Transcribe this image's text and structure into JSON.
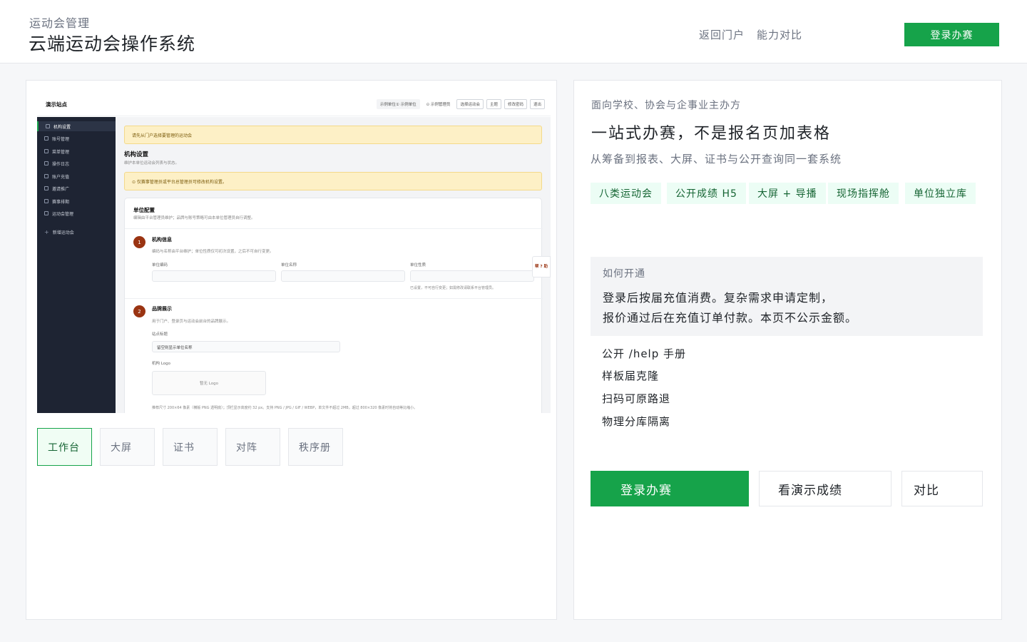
{
  "header": {
    "subtitle": "运动会管理",
    "title": "云端运动会操作系统",
    "nav_back": "返回门户",
    "nav_compare": "能力对比",
    "login_button": "登录办赛"
  },
  "preview": {
    "site_name": "演示站点",
    "top_chips": [
      "示例单位① 示例单位",
      "⊙ 示例管理员",
      "选择运动会",
      "主题",
      "修改密码",
      "退出"
    ],
    "sidebar": [
      "机构设置",
      "账号管理",
      "菜单管理",
      "操作日志",
      "账户充值",
      "邀请推广",
      "赛事排期",
      "运动会管理",
      "新增运动会"
    ],
    "alert_select": "请先从门户选择要管理的运动会",
    "page_title": "机构设置",
    "page_subtitle": "维护本单位运动会列表与状态。",
    "alert_permission": "⊙ 仅赛事管理员或平台总管理员可修改机构设置。",
    "panel_title": "单位配置",
    "panel_subtitle": "编辑由平台管理员维护；品牌与账号策略可由本单位管理员自行调整。",
    "step1": {
      "num": "1",
      "title": "机构信息",
      "desc": "编码与名称由平台维护；单位性质仅可初次设置，之后不可自行变更。",
      "label_code": "单位编码",
      "label_name": "单位名称",
      "label_type": "单位性质",
      "hint": "已设置，不可自行变更；如需修改请联系平台管理员。"
    },
    "step2": {
      "num": "2",
      "title": "品牌展示",
      "desc": "用于门户、登录页与运动会前台的品牌展示。",
      "label_site_title": "站点标题",
      "site_title_placeholder": "留空则显示单位名称",
      "label_logo": "机构 Logo",
      "logo_placeholder": "暂无 Logo",
      "logo_hint": "推荐尺寸 200×64 像素（横版 PNG 透明底）；顶栏显示高度约 32 px。支持 PNG / JPG / GIF / WEBP，单文件不超过 2MB，超过 800×320 像素时将自动等比缩小。"
    },
    "help_tab": "帮 ? 助"
  },
  "preview_tabs": [
    "工作台",
    "大屏",
    "证书",
    "对阵",
    "秩序册"
  ],
  "active_tab": "工作台",
  "intro": {
    "eyebrow": "面向学校、协会与企事业主办方",
    "title": "一站式办赛，不是报名页加表格",
    "description": "从筹备到报表、大屏、证书与公开查询同一套系统",
    "tags": [
      "八类运动会",
      "公开成绩 H5",
      "大屏 + 导播",
      "现场指挥舱",
      "单位独立库"
    ]
  },
  "howto": {
    "title": "如何开通",
    "line1": "登录后按届充值消费。复杂需求申请定制，",
    "line2": "报价通过后在充值订单付款。本页不公示金额。"
  },
  "features": [
    "公开 /help 手册",
    "样板届克隆",
    "扫码可原路退",
    "物理分库隔离"
  ],
  "actions": {
    "login": "登录办赛",
    "demo": "看演示成绩",
    "compare": "对比"
  },
  "colors": {
    "brand_green": "#16a34a",
    "sidebar_dark": "#1e2433",
    "alert_yellow": "#fdf0c6",
    "step_badge": "#9a3412"
  }
}
